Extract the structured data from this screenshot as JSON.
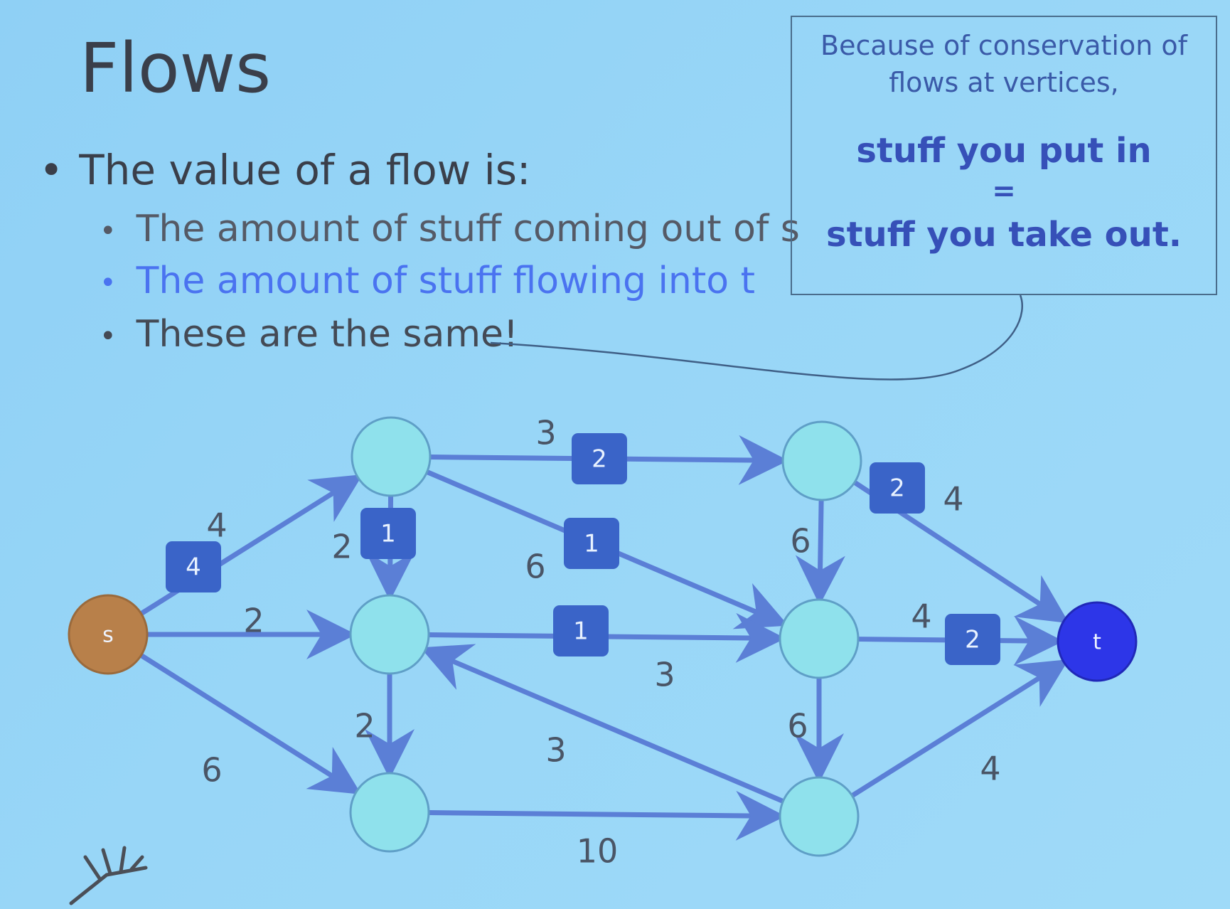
{
  "slide": {
    "title": "Flows",
    "bullet_main": "The value of a flow is:",
    "sub_bullets": [
      "The amount of stuff coming out of s",
      "The amount of stuff flowing into t",
      "These are the same!"
    ],
    "bullet_glyph": "•"
  },
  "callout": {
    "intro_line1": "Because of conservation of",
    "intro_line2": "flows at vertices,",
    "line1": "stuff you put in",
    "equals": "=",
    "line2": "stuff you take out."
  },
  "graph": {
    "colors": {
      "edge": "#5b7fd6",
      "node_fill": "#8fe1ec",
      "node_stroke": "#5f9fc7",
      "source": "#b8804a",
      "sink": "#2d36e8",
      "flow_box": "#3a64c8"
    },
    "nodes": [
      {
        "id": "s",
        "label": "s"
      },
      {
        "id": "a1",
        "label": ""
      },
      {
        "id": "a2",
        "label": ""
      },
      {
        "id": "a3",
        "label": ""
      },
      {
        "id": "b1",
        "label": ""
      },
      {
        "id": "b2",
        "label": ""
      },
      {
        "id": "b3",
        "label": ""
      },
      {
        "id": "t",
        "label": "t"
      }
    ],
    "edges": [
      {
        "from": "s",
        "to": "a1",
        "capacity": "4",
        "flow": "4"
      },
      {
        "from": "s",
        "to": "a2",
        "capacity": "2",
        "flow": ""
      },
      {
        "from": "s",
        "to": "a3",
        "capacity": "6",
        "flow": ""
      },
      {
        "from": "a1",
        "to": "b1",
        "capacity": "3",
        "flow": "2"
      },
      {
        "from": "a1",
        "to": "a2",
        "capacity": "2",
        "flow": "1"
      },
      {
        "from": "a1",
        "to": "b2",
        "capacity": "6",
        "flow": "1"
      },
      {
        "from": "a2",
        "to": "b2",
        "capacity": "3",
        "flow": "1"
      },
      {
        "from": "a2",
        "to": "a3",
        "capacity": "2",
        "flow": ""
      },
      {
        "from": "b3",
        "to": "a2",
        "capacity": "3",
        "flow": ""
      },
      {
        "from": "a3",
        "to": "b3",
        "capacity": "10",
        "flow": ""
      },
      {
        "from": "b1",
        "to": "b2",
        "capacity": "6",
        "flow": ""
      },
      {
        "from": "b1",
        "to": "t",
        "capacity": "4",
        "flow": "2"
      },
      {
        "from": "b2",
        "to": "t",
        "capacity": "4",
        "flow": "2"
      },
      {
        "from": "b2",
        "to": "b3",
        "capacity": "6",
        "flow": ""
      },
      {
        "from": "b3",
        "to": "t",
        "capacity": "4",
        "flow": ""
      }
    ]
  }
}
